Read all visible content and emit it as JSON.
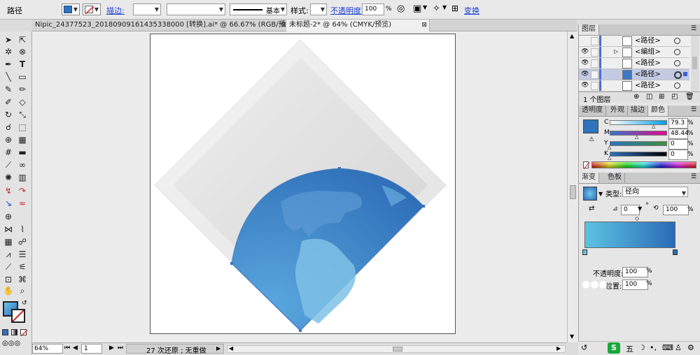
{
  "control_bar": {
    "selection_type": "路径",
    "stroke_label": "描边:",
    "stroke_style_name": "基本",
    "style_label": "样式:",
    "opacity_label": "不透明度:",
    "opacity_value": "100",
    "opacity_unit": "%",
    "transform_label": "变换"
  },
  "document_tabs": [
    {
      "label": "Nipic_24377523_20180909161435338000 [转换].ai* @ 66.67% (RGB/预览)",
      "active": false
    },
    {
      "label": "未标题-2* @ 64% (CMYK/预览)",
      "active": true
    }
  ],
  "tab_close_glyph": "⊠",
  "layers_panel": {
    "title": "图层",
    "rows": [
      {
        "name": "<路径>",
        "selected": false
      },
      {
        "name": "<编组>",
        "selected": false,
        "expandable": true
      },
      {
        "name": "<路径>",
        "selected": false
      },
      {
        "name": "<路径>",
        "selected": true
      },
      {
        "name": "<路径>",
        "selected": false
      }
    ],
    "footer_count": "1 个图层"
  },
  "color_panel": {
    "tabs": [
      "透明度",
      "外观",
      "描边",
      "颜色"
    ],
    "active_tab": "颜色",
    "channels": [
      {
        "label": "C",
        "value": "79.3"
      },
      {
        "label": "M",
        "value": "48.44"
      },
      {
        "label": "Y",
        "value": "0"
      },
      {
        "label": "K",
        "value": "0"
      }
    ],
    "unit": "%",
    "swatch_color": "#2e73bc"
  },
  "gradient_panel": {
    "tabs": [
      "渐变",
      "色板"
    ],
    "active_tab": "渐变",
    "type_label": "类型:",
    "type_value": "径向",
    "angle_value": "0",
    "angle_unit": "°",
    "aspect_value": "100",
    "aspect_unit": "%",
    "opacity_label": "不透明度:",
    "opacity_value": "100",
    "opacity_unit": "%",
    "location_label": "位置:",
    "location_value": "100",
    "location_unit": "%",
    "start_color": "#5cc3e2",
    "end_color": "#2c6ab8"
  },
  "status_bar": {
    "zoom": "64%",
    "artboard": "1",
    "undo_status": "27 次还原 ; 无重做"
  },
  "taskbar": {
    "ime_char": "五"
  },
  "colors": {
    "globe_dark": "#2f6fb8",
    "globe_light": "#7fc1e6",
    "accent_link": "#1b3fd1"
  }
}
